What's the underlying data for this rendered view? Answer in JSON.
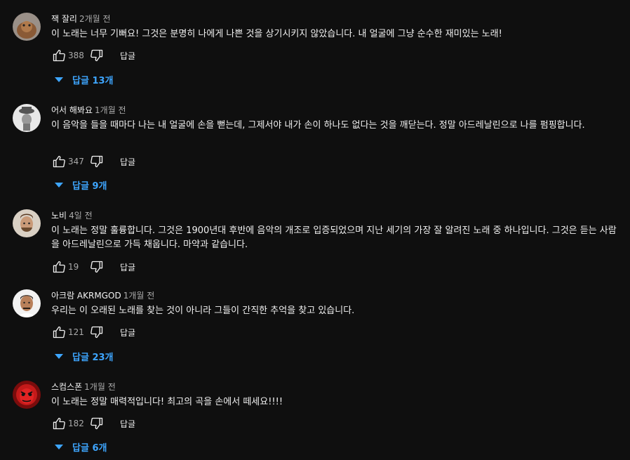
{
  "comments": [
    {
      "author": "잭 잘리",
      "time": "2개월 전",
      "text": "이 노래는 너무 기뻐요! 그것은 분명히 나에게 나쁜 것을 상기시키지 않았습니다. 내 얼굴에 그냥 순수한 재미있는 노래!",
      "likes": "388",
      "reply_label": "답글",
      "replies_label": "답글 13개"
    },
    {
      "author": "어서 해봐요",
      "time": "1개월 전",
      "text": "이 음악을 들을 때마다 나는 내 얼굴에 손을 뻗는데, 그제서야 내가 손이 하나도 없다는 것을 깨닫는다. 정말 아드레날린으로 나를 펌핑합니다.",
      "likes": "347",
      "reply_label": "답글",
      "replies_label": "답글 9개"
    },
    {
      "author": "노비",
      "time": "4일 전",
      "text": "이 노래는 정말 훌륭합니다. 그것은 1900년대 후반에 음악의 개조로 입증되었으며 지난 세기의 가장 잘 알려진 노래 중 하나입니다. 그것은 듣는 사람을 아드레날린으로 가득 채웁니다. 마약과 같습니다.",
      "likes": "19",
      "reply_label": "답글"
    },
    {
      "author": "아크람 AKRMGOD",
      "time": "1개월 전",
      "text": "우리는 이 오래된 노래를 찾는 것이 아니라 그들이 간직한 추억을 찾고 있습니다.",
      "likes": "121",
      "reply_label": "답글",
      "replies_label": "답글 23개"
    },
    {
      "author": "스컴스폰",
      "time": "1개월 전",
      "text": "이 노래는 정말 매력적입니다! 최고의 곡을 손에서 떼세요!!!!",
      "likes": "182",
      "reply_label": "답글",
      "replies_label": "답글 6개"
    }
  ],
  "colors": {
    "background": "#0f0f0f",
    "text": "#f1f1f1",
    "muted": "#aaaaaa",
    "link": "#3ea6ff"
  },
  "icons": {
    "like": "thumbs-up-icon",
    "dislike": "thumbs-down-icon",
    "expand": "caret-down-icon"
  }
}
